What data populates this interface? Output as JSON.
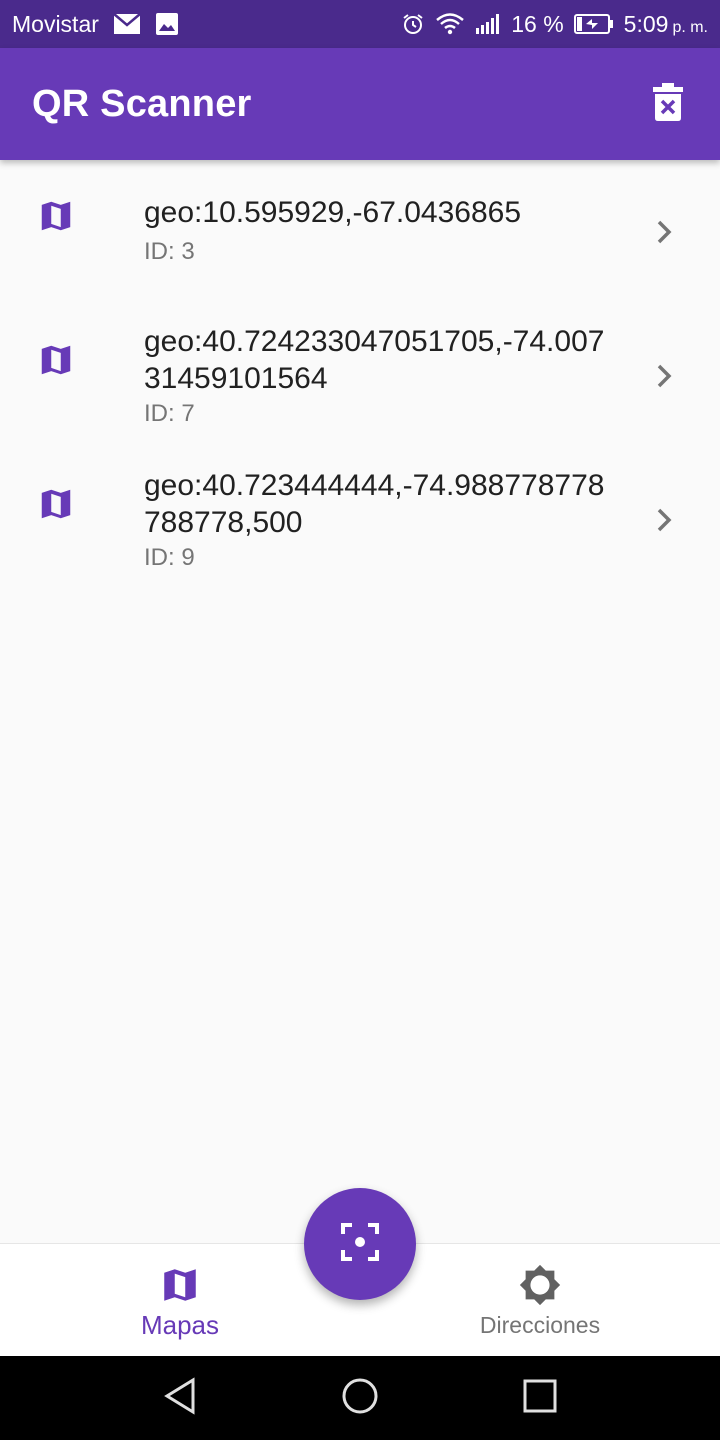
{
  "status_bar": {
    "carrier": "Movistar",
    "battery_percent": "16 %",
    "time": "5:09",
    "ampm": "p. m."
  },
  "app_bar": {
    "title": "QR Scanner",
    "delete_icon": "delete-forever-icon"
  },
  "scans": [
    {
      "title": "geo:10.595929,-67.0436865",
      "subtitle": "ID: 3",
      "icon": "map-icon"
    },
    {
      "title": "geo:40.724233047051705,-74.00731459101564",
      "subtitle": "ID: 7",
      "icon": "map-icon"
    },
    {
      "title": "geo:40.723444444,-74.988778778788778,500",
      "subtitle": "ID: 9",
      "icon": "map-icon"
    }
  ],
  "bottom_nav": {
    "items": [
      {
        "label": "Mapas",
        "icon": "map-icon",
        "active": true
      },
      {
        "label": "Direcciones",
        "icon": "brightness-icon",
        "active": false
      }
    ]
  },
  "fab": {
    "icon": "center-focus-icon"
  },
  "colors": {
    "primary": "#673ab7",
    "status_bar": "#4a2a8c",
    "background": "#fafafa",
    "text_primary": "#212121",
    "text_secondary": "#757575"
  }
}
